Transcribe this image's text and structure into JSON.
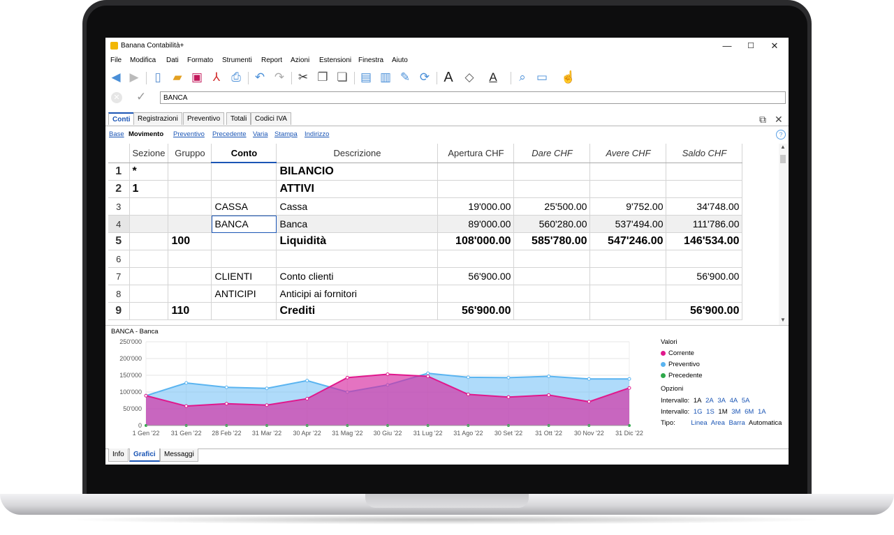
{
  "app": {
    "title": "Banana Contabilità+"
  },
  "window_controls": {
    "minimize": "—",
    "maximize": "☐",
    "close": "✕"
  },
  "menu": [
    "File",
    "Modifica",
    "Dati",
    "Formato",
    "Strumenti",
    "Report",
    "Azioni",
    "Estensioni",
    "Finestra",
    "Aiuto"
  ],
  "toolbar": {
    "icons": [
      "back-icon",
      "forward-icon",
      "new-file-icon",
      "open-folder-icon",
      "save-icon",
      "pdf-icon",
      "print-preview-icon",
      "undo-icon",
      "redo-icon",
      "cut-icon",
      "copy-icon",
      "paste-icon",
      "insert-row-icon",
      "delete-row-icon",
      "edit-icon",
      "refresh-icon",
      "font-icon",
      "fill-color-icon",
      "text-color-icon",
      "search-icon",
      "view-icon",
      "like-icon"
    ]
  },
  "formula_bar": {
    "value": "BANCA"
  },
  "tabs": [
    "Conti",
    "Registrazioni",
    "Preventivo",
    "Totali",
    "Codici IVA"
  ],
  "subtabs": [
    "Base",
    "Movimento",
    "Preventivo",
    "Precedente",
    "Varia",
    "Stampa",
    "Indirizzo"
  ],
  "table": {
    "columns": [
      "Sezione",
      "Gruppo",
      "Conto",
      "Descrizione",
      "Apertura CHF",
      "Dare CHF",
      "Avere CHF",
      "Saldo CHF"
    ],
    "rows": [
      {
        "n": "1",
        "sezione": "*",
        "gruppo": "",
        "conto": "",
        "descrizione": "BILANCIO",
        "apertura": "",
        "dare": "",
        "avere": "",
        "saldo": ""
      },
      {
        "n": "2",
        "sezione": "1",
        "gruppo": "",
        "conto": "",
        "descrizione": "ATTIVI",
        "apertura": "",
        "dare": "",
        "avere": "",
        "saldo": ""
      },
      {
        "n": "3",
        "sezione": "",
        "gruppo": "",
        "conto": "CASSA",
        "descrizione": "Cassa",
        "apertura": "19'000.00",
        "dare": "25'500.00",
        "avere": "9'752.00",
        "saldo": "34'748.00"
      },
      {
        "n": "4",
        "sezione": "",
        "gruppo": "",
        "conto": "BANCA",
        "descrizione": "Banca",
        "apertura": "89'000.00",
        "dare": "560'280.00",
        "avere": "537'494.00",
        "saldo": "111'786.00"
      },
      {
        "n": "5",
        "sezione": "",
        "gruppo": "100",
        "conto": "",
        "descrizione": "Liquidità",
        "apertura": "108'000.00",
        "dare": "585'780.00",
        "avere": "547'246.00",
        "saldo": "146'534.00"
      },
      {
        "n": "6",
        "sezione": "",
        "gruppo": "",
        "conto": "",
        "descrizione": "",
        "apertura": "",
        "dare": "",
        "avere": "",
        "saldo": ""
      },
      {
        "n": "7",
        "sezione": "",
        "gruppo": "",
        "conto": "CLIENTI",
        "descrizione": "Conto clienti",
        "apertura": "56'900.00",
        "dare": "",
        "avere": "",
        "saldo": "56'900.00"
      },
      {
        "n": "8",
        "sezione": "",
        "gruppo": "",
        "conto": "ANTICIPI",
        "descrizione": "Anticipi ai fornitori",
        "apertura": "",
        "dare": "",
        "avere": "",
        "saldo": ""
      },
      {
        "n": "9",
        "sezione": "",
        "gruppo": "110",
        "conto": "",
        "descrizione": "Crediti",
        "apertura": "56'900.00",
        "dare": "",
        "avere": "",
        "saldo": "56'900.00"
      }
    ]
  },
  "chart_title": "BANCA - Banca",
  "chart_data": {
    "type": "area",
    "categories": [
      "1 Gen '22",
      "31 Gen '22",
      "28 Feb '22",
      "31 Mar '22",
      "30 Apr '22",
      "31 Mag '22",
      "30 Giu '22",
      "31 Lug '22",
      "31 Ago '22",
      "30 Set '22",
      "31 Ott '22",
      "30 Nov '22",
      "31 Dic '22"
    ],
    "y_ticks": [
      "0",
      "50'000",
      "100'000",
      "150'000",
      "200'000",
      "250'000"
    ],
    "ylim": [
      0,
      250000
    ],
    "series": [
      {
        "name": "Preventivo",
        "color": "#5ab4f0",
        "values": [
          89000,
          127000,
          114000,
          111000,
          134000,
          100000,
          121000,
          156000,
          144000,
          143000,
          147000,
          139000,
          139000
        ]
      },
      {
        "name": "Corrente",
        "color": "#e0188c",
        "values": [
          89000,
          58000,
          65000,
          61000,
          80000,
          143000,
          153000,
          147000,
          93000,
          85000,
          91000,
          71000,
          112000
        ]
      }
    ]
  },
  "legend": {
    "valori_label": "Valori",
    "items": [
      {
        "name": "Corrente",
        "color": "#e0188c"
      },
      {
        "name": "Preventivo",
        "color": "#5ab4f0"
      },
      {
        "name": "Precedente",
        "color": "#2ea84a"
      }
    ],
    "opzioni_label": "Opzioni",
    "intervallo_label": "Intervallo:",
    "intervallo_1": [
      "1A",
      "2A",
      "3A",
      "4A",
      "5A"
    ],
    "intervallo_2": [
      "1G",
      "1S",
      "1M",
      "3M",
      "6M",
      "1A"
    ],
    "tipo_label": "Tipo:",
    "tipo": [
      "Linea",
      "Area",
      "Barra",
      "Automatica"
    ]
  },
  "bottom_tabs": [
    "Info",
    "Grafici",
    "Messaggi"
  ]
}
